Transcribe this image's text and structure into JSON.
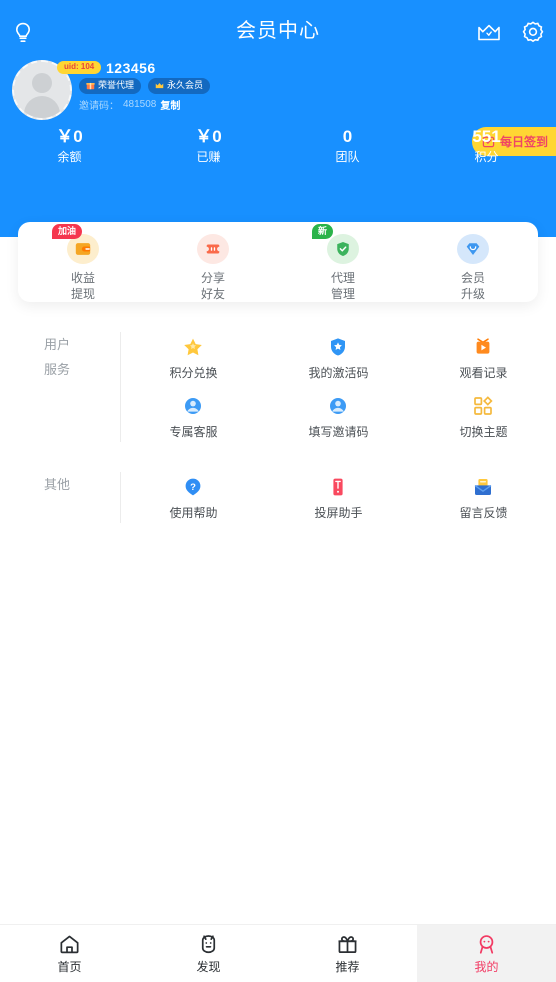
{
  "header": {
    "title": "会员中心",
    "icons": {
      "left": "bulb-icon",
      "crown": "crown-icon",
      "gear": "gear-icon"
    }
  },
  "profile": {
    "uid_badge": "uid: 104",
    "username": "123456",
    "tags": [
      {
        "label": "荣誉代理",
        "icon": "gift-icon"
      },
      {
        "label": "永久会员",
        "icon": "crown-icon"
      }
    ],
    "invite_label": "邀请码：",
    "invite_code": "481508",
    "copy_label": "复制",
    "signin_label": "每日签到"
  },
  "stats": [
    {
      "value": "￥0",
      "label": "余额"
    },
    {
      "value": "￥0",
      "label": "已赚"
    },
    {
      "value": "0",
      "label": "团队"
    },
    {
      "value": "551",
      "label": "积分"
    }
  ],
  "actions": [
    {
      "label_top": "收益",
      "label_bottom": "提现",
      "icon": "wallet-icon",
      "badge": "加油",
      "badge_color": "#f5374f"
    },
    {
      "label_top": "分享",
      "label_bottom": "好友",
      "icon": "ticket-icon",
      "badge": "",
      "badge_color": ""
    },
    {
      "label_top": "代理",
      "label_bottom": "管理",
      "icon": "shield-check-icon",
      "badge": "新",
      "badge_color": "#2bb34a"
    },
    {
      "label_top": "会员",
      "label_bottom": "升级",
      "icon": "diamond-icon",
      "badge": "",
      "badge_color": ""
    }
  ],
  "sections": [
    {
      "title_line1": "用户",
      "title_line2": "服务",
      "items": [
        {
          "label": "积分兑换",
          "icon": "star-icon"
        },
        {
          "label": "我的激活码",
          "icon": "shield-star-icon"
        },
        {
          "label": "观看记录",
          "icon": "tv-play-icon"
        },
        {
          "label": "专属客服",
          "icon": "headset-icon"
        },
        {
          "label": "填写邀请码",
          "icon": "headset-icon"
        },
        {
          "label": "切换主题",
          "icon": "theme-grid-icon"
        }
      ]
    },
    {
      "title_line1": "其他",
      "title_line2": "",
      "items": [
        {
          "label": "使用帮助",
          "icon": "question-icon"
        },
        {
          "label": "投屏助手",
          "icon": "cast-icon"
        },
        {
          "label": "留言反馈",
          "icon": "envelope-icon"
        }
      ]
    }
  ],
  "tabbar": [
    {
      "label": "首页",
      "icon": "home-icon",
      "active": false
    },
    {
      "label": "发现",
      "icon": "discover-icon",
      "active": false
    },
    {
      "label": "推荐",
      "icon": "gift-icon",
      "active": false
    },
    {
      "label": "我的",
      "icon": "profile-icon",
      "active": true
    }
  ],
  "colors": {
    "primary": "#1890ff",
    "accent_yellow": "#ffd633",
    "accent_pink": "#f23a63",
    "badge_red": "#f5374f",
    "badge_green": "#2bb34a"
  }
}
